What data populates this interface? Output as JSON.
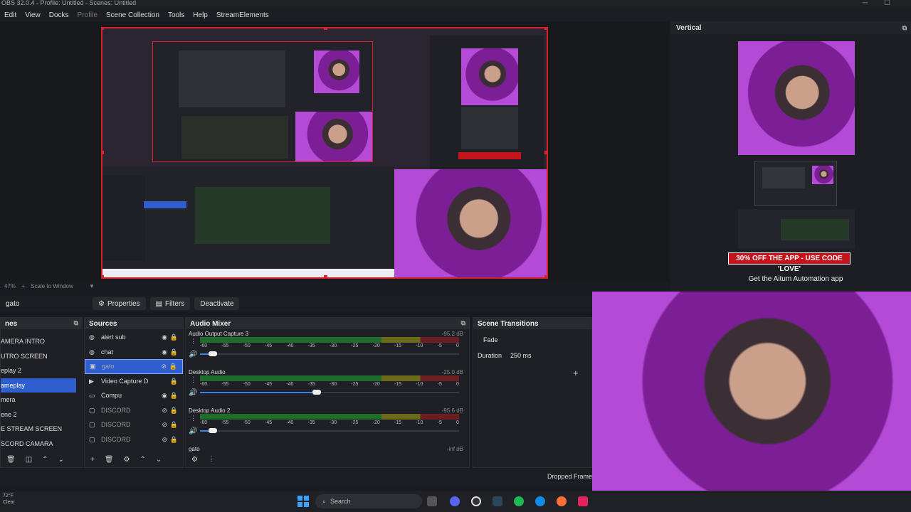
{
  "window": {
    "title": "OBS 32.0.4 - Profile: Untitled - Scenes: Untitled"
  },
  "menu": [
    "Edit",
    "View",
    "Docks",
    "Profile",
    "Scene Collection",
    "Tools",
    "Help",
    "StreamElements"
  ],
  "preview": {
    "zoom": "47%",
    "scale_mode": "Scale to Window"
  },
  "vertical": {
    "title": "Vertical",
    "promo": "30% OFF THE APP - USE CODE 'LOVE'",
    "promo_sub": "Get the Aitum Automation app"
  },
  "controls": {
    "selected_source": "gato",
    "properties": "Properties",
    "filters": "Filters",
    "deactivate": "Deactivate"
  },
  "scenes": {
    "title": "nes",
    "items": [
      "AMERA INTRO",
      "UTRO SCREEN",
      "eplay 2",
      "ameplay",
      "mera",
      "ene 2",
      "E STREAM SCREEN",
      "SCORD CAMARA"
    ],
    "selected": 3
  },
  "sources": {
    "title": "Sources",
    "items": [
      {
        "label": "alert sub",
        "icon": "globe"
      },
      {
        "label": "chat",
        "icon": "globe"
      },
      {
        "label": "gato",
        "icon": "image"
      },
      {
        "label": "Video Capture D",
        "icon": "camera"
      },
      {
        "label": "Compu",
        "icon": "monitor"
      },
      {
        "label": "DISCORD",
        "icon": "window"
      },
      {
        "label": "DISCORD",
        "icon": "window"
      },
      {
        "label": "DISCORD",
        "icon": "window"
      }
    ]
  },
  "mixer": {
    "title": "Audio Mixer",
    "scale": [
      "-60",
      "-55",
      "-50",
      "-45",
      "-40",
      "-35",
      "-30",
      "-25",
      "-20",
      "-15",
      "-10",
      "-5",
      "0"
    ],
    "channels": [
      {
        "name": "Audio Output Capture 3",
        "db": "-95.2 dB",
        "level": 0.0,
        "volume": 0.05
      },
      {
        "name": "Desktop Audio",
        "db": "-25.0 dB",
        "level": 0.0,
        "volume": 0.45
      },
      {
        "name": "Desktop Audio 2",
        "db": "-95.6 dB",
        "level": 0.0,
        "volume": 0.05
      },
      {
        "name": "gato",
        "db": "-inf dB",
        "level": 0.0,
        "volume": 0.0
      }
    ]
  },
  "transitions": {
    "title": "Scene Transitions",
    "type": "Fade",
    "duration_label": "Duration",
    "duration": "250 ms"
  },
  "statusbar": {
    "dropped": "Dropped Frame"
  },
  "taskbar": {
    "temp": "72°F",
    "weather": "Clear",
    "search": "Search"
  }
}
